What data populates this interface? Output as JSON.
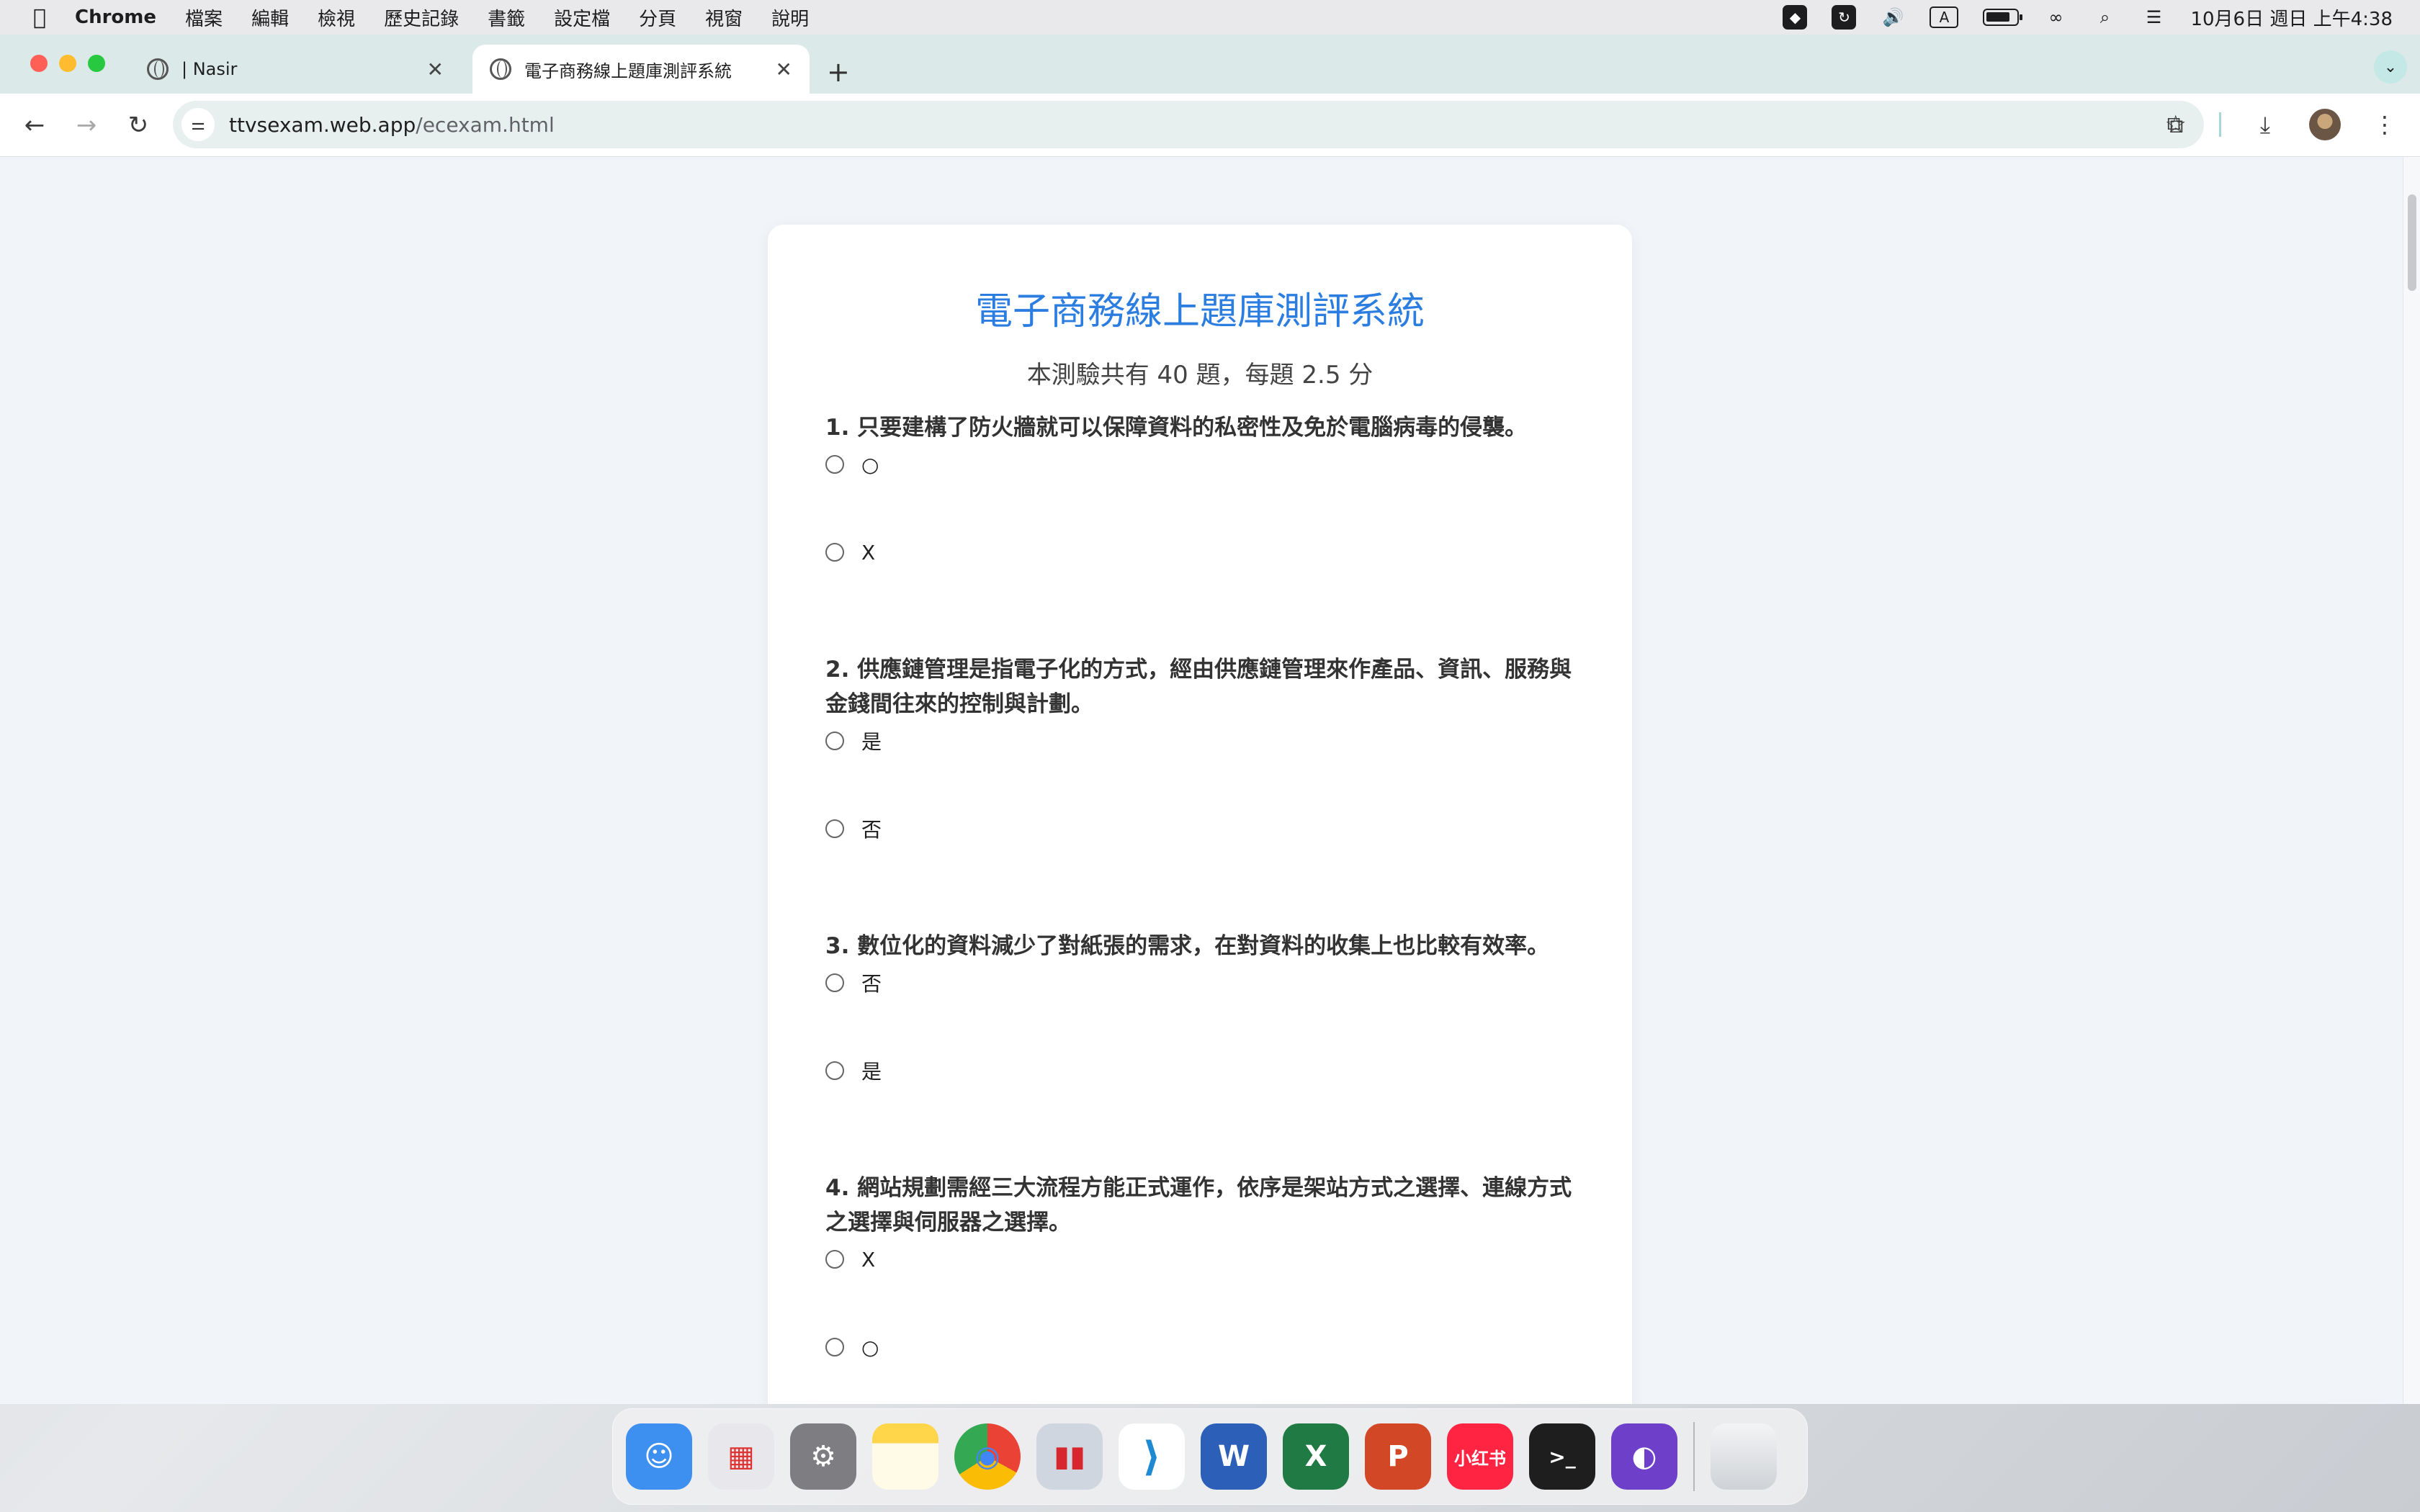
{
  "menubar": {
    "app_name": "Chrome",
    "menus": [
      "檔案",
      "編輯",
      "檢視",
      "歷史記錄",
      "書籤",
      "設定檔",
      "分頁",
      "視窗",
      "說明"
    ],
    "input_indicator": "A",
    "clock": "10月6日 週日 上午4:38"
  },
  "browser": {
    "tabs": [
      {
        "title": "| Nasir",
        "active": false
      },
      {
        "title": "電子商務線上題庫測評系統",
        "active": true
      }
    ],
    "url_host": "ttvsexam.web.app",
    "url_path": "/ecexam.html"
  },
  "page": {
    "title": "電子商務線上題庫測評系統",
    "subtitle": "本測驗共有 40 題，每題 2.5 分",
    "questions": [
      {
        "text": "1. 只要建構了防火牆就可以保障資料的私密性及免於電腦病毒的侵襲。",
        "options": [
          "○",
          "X"
        ]
      },
      {
        "text": "2. 供應鏈管理是指電子化的方式，經由供應鏈管理來作產品、資訊、服務與金錢間往來的控制與計劃。",
        "options": [
          "是",
          "否"
        ]
      },
      {
        "text": "3. 數位化的資料減少了對紙張的需求，在對資料的收集上也比較有效率。",
        "options": [
          "否",
          "是"
        ]
      },
      {
        "text": "4. 網站規劃需經三大流程方能正式運作，依序是架站方式之選擇、連線方式之選擇與伺服器之選擇。",
        "options": [
          "X",
          "○"
        ]
      }
    ]
  },
  "dock": {
    "apps": [
      {
        "name": "Finder",
        "label": "☺",
        "color": "#3d8ff0"
      },
      {
        "name": "Launchpad",
        "label": "▦",
        "color": "#e8e8ec"
      },
      {
        "name": "System Settings",
        "label": "⚙",
        "color": "#7d7d82"
      },
      {
        "name": "Notes",
        "label": "",
        "color": "#ffd54a"
      },
      {
        "name": "Chrome",
        "label": "◉",
        "color": "#ffffff"
      },
      {
        "name": "Parallels",
        "label": "▮▮",
        "color": "#cfd6df"
      },
      {
        "name": "VS Code",
        "label": "⟩",
        "color": "#ffffff"
      },
      {
        "name": "Word",
        "label": "W",
        "color": "#2b5fb8"
      },
      {
        "name": "Excel",
        "label": "X",
        "color": "#1f7a43"
      },
      {
        "name": "PowerPoint",
        "label": "P",
        "color": "#d24726"
      },
      {
        "name": "小红书",
        "label": "小红书",
        "color": "#ff2442"
      },
      {
        "name": "Terminal",
        "label": ">_",
        "color": "#1e1e1e"
      },
      {
        "name": "GitHub Desktop",
        "label": "◐",
        "color": "#6e40c9"
      },
      {
        "name": "Trash",
        "label": "",
        "color": "#dfe1e5"
      }
    ]
  }
}
